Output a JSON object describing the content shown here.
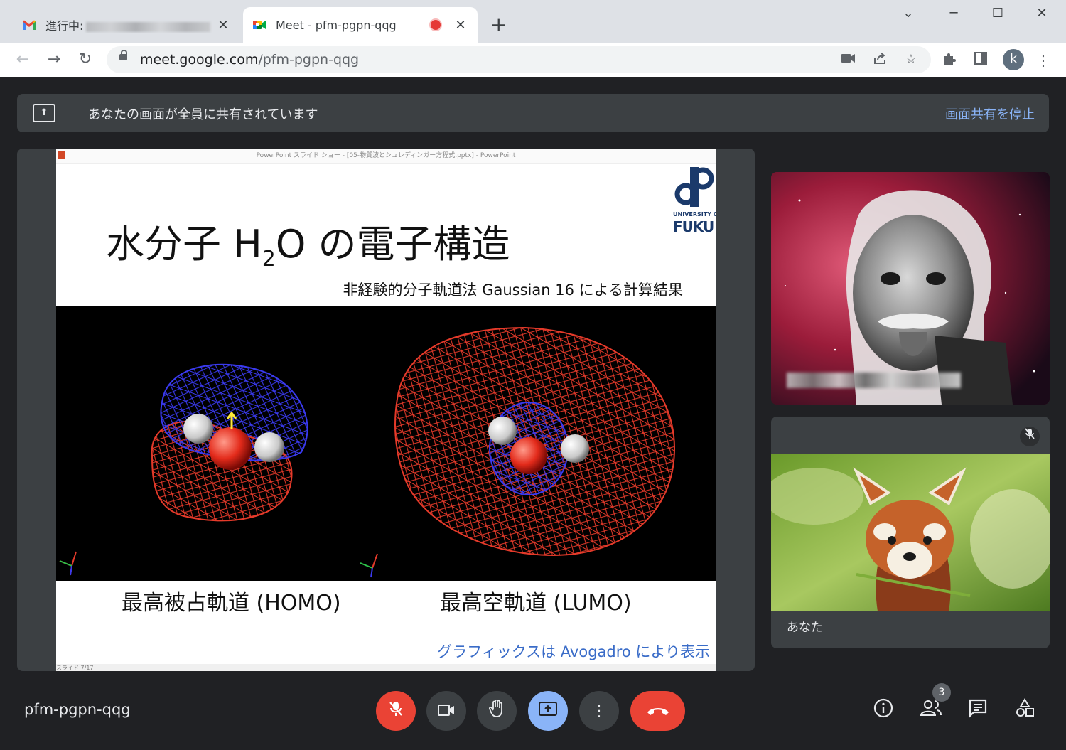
{
  "browser": {
    "tabs": [
      {
        "title": "進行中:",
        "active": false,
        "icon": "gmail-icon"
      },
      {
        "title": "Meet - pfm-pgpn-qqg",
        "active": true,
        "icon": "meet-icon"
      }
    ],
    "new_tab_label": "+",
    "window_controls": {
      "minimize": "─",
      "maximize": "☐",
      "close": "✕",
      "tab_search": "⌄"
    },
    "url_host": "meet.google.com",
    "url_path": "/pfm-pgpn-qqg",
    "profile_initial": "k"
  },
  "banner": {
    "message": "あなたの画面が全員に共有されています",
    "stop_label": "画面共有を停止"
  },
  "slide": {
    "window_title": "PowerPoint スライド ショー - [05-物質波とシュレディンガー方程式.pptx] - PowerPoint",
    "title_prefix": "水分子 H",
    "title_sub": "2",
    "title_suffix": "O の電子構造",
    "subtitle": "非経験的分子軌道法 Gaussian 16 による計算結果",
    "caption_homo": "最高被占軌道 (HOMO)",
    "caption_lumo": "最高空軌道 (LUMO)",
    "credit": "グラフィックスは Avogadro により表示",
    "logo_university": "UNIVERSITY OF",
    "logo_name": "FUKU",
    "slide_number": "スライド 7/17"
  },
  "participants": {
    "self_name": "あなた"
  },
  "meeting": {
    "code": "pfm-pgpn-qqg",
    "participant_count": "3"
  },
  "colors": {
    "meet_bg": "#202124",
    "tile_bg": "#3c4043",
    "end_call": "#ea4335",
    "present_active": "#8ab4f8",
    "link": "#8ab4f8"
  }
}
